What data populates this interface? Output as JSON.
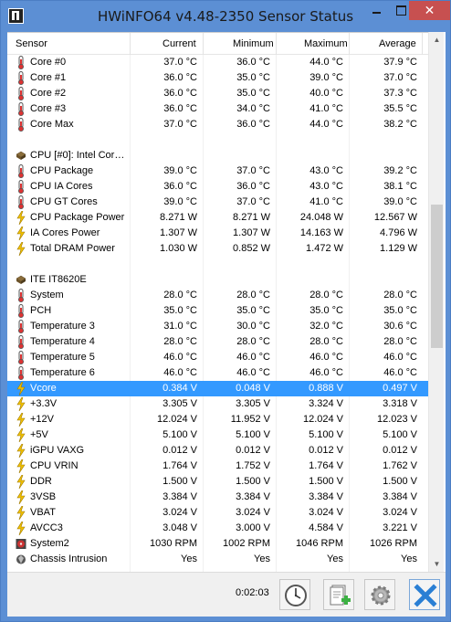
{
  "window": {
    "title": "HWiNFO64 v4.48-2350 Sensor Status",
    "close_label": "✕"
  },
  "columns": [
    "Sensor",
    "Current",
    "Minimum",
    "Maximum",
    "Average"
  ],
  "rows": [
    {
      "icon": "thermometer-icon",
      "label": "Core #0",
      "cur": "37.0 °C",
      "min": "36.0 °C",
      "max": "44.0 °C",
      "avg": "37.9 °C"
    },
    {
      "icon": "thermometer-icon",
      "label": "Core #1",
      "cur": "36.0 °C",
      "min": "35.0 °C",
      "max": "39.0 °C",
      "avg": "37.0 °C"
    },
    {
      "icon": "thermometer-icon",
      "label": "Core #2",
      "cur": "36.0 °C",
      "min": "35.0 °C",
      "max": "40.0 °C",
      "avg": "37.3 °C"
    },
    {
      "icon": "thermometer-icon",
      "label": "Core #3",
      "cur": "36.0 °C",
      "min": "34.0 °C",
      "max": "41.0 °C",
      "avg": "35.5 °C"
    },
    {
      "icon": "thermometer-icon",
      "label": "Core Max",
      "cur": "37.0 °C",
      "min": "36.0 °C",
      "max": "44.0 °C",
      "avg": "38.2 °C"
    },
    {
      "icon": "",
      "label": "",
      "cur": "",
      "min": "",
      "max": "",
      "avg": ""
    },
    {
      "icon": "chip-icon",
      "label": "CPU [#0]: Intel Cor…",
      "cur": "",
      "min": "",
      "max": "",
      "avg": "",
      "group": true
    },
    {
      "icon": "thermometer-icon",
      "label": "CPU Package",
      "cur": "39.0 °C",
      "min": "37.0 °C",
      "max": "43.0 °C",
      "avg": "39.2 °C"
    },
    {
      "icon": "thermometer-icon",
      "label": "CPU IA Cores",
      "cur": "36.0 °C",
      "min": "36.0 °C",
      "max": "43.0 °C",
      "avg": "38.1 °C"
    },
    {
      "icon": "thermometer-icon",
      "label": "CPU GT Cores",
      "cur": "39.0 °C",
      "min": "37.0 °C",
      "max": "41.0 °C",
      "avg": "39.0 °C"
    },
    {
      "icon": "lightning-icon",
      "label": "CPU Package Power",
      "cur": "8.271 W",
      "min": "8.271 W",
      "max": "24.048 W",
      "avg": "12.567 W"
    },
    {
      "icon": "lightning-icon",
      "label": "IA Cores Power",
      "cur": "1.307 W",
      "min": "1.307 W",
      "max": "14.163 W",
      "avg": "4.796 W"
    },
    {
      "icon": "lightning-icon",
      "label": "Total DRAM Power",
      "cur": "1.030 W",
      "min": "0.852 W",
      "max": "1.472 W",
      "avg": "1.129 W"
    },
    {
      "icon": "",
      "label": "",
      "cur": "",
      "min": "",
      "max": "",
      "avg": ""
    },
    {
      "icon": "chip-icon",
      "label": "ITE IT8620E",
      "cur": "",
      "min": "",
      "max": "",
      "avg": "",
      "group": true
    },
    {
      "icon": "thermometer-icon",
      "label": "System",
      "cur": "28.0 °C",
      "min": "28.0 °C",
      "max": "28.0 °C",
      "avg": "28.0 °C"
    },
    {
      "icon": "thermometer-icon",
      "label": "PCH",
      "cur": "35.0 °C",
      "min": "35.0 °C",
      "max": "35.0 °C",
      "avg": "35.0 °C"
    },
    {
      "icon": "thermometer-icon",
      "label": "Temperature 3",
      "cur": "31.0 °C",
      "min": "30.0 °C",
      "max": "32.0 °C",
      "avg": "30.6 °C"
    },
    {
      "icon": "thermometer-icon",
      "label": "Temperature 4",
      "cur": "28.0 °C",
      "min": "28.0 °C",
      "max": "28.0 °C",
      "avg": "28.0 °C"
    },
    {
      "icon": "thermometer-icon",
      "label": "Temperature 5",
      "cur": "46.0 °C",
      "min": "46.0 °C",
      "max": "46.0 °C",
      "avg": "46.0 °C"
    },
    {
      "icon": "thermometer-icon",
      "label": "Temperature 6",
      "cur": "46.0 °C",
      "min": "46.0 °C",
      "max": "46.0 °C",
      "avg": "46.0 °C"
    },
    {
      "icon": "lightning-icon",
      "label": "Vcore",
      "cur": "0.384 V",
      "min": "0.048 V",
      "max": "0.888 V",
      "avg": "0.497 V",
      "selected": true
    },
    {
      "icon": "lightning-icon",
      "label": "+3.3V",
      "cur": "3.305 V",
      "min": "3.305 V",
      "max": "3.324 V",
      "avg": "3.318 V"
    },
    {
      "icon": "lightning-icon",
      "label": "+12V",
      "cur": "12.024 V",
      "min": "11.952 V",
      "max": "12.024 V",
      "avg": "12.023 V"
    },
    {
      "icon": "lightning-icon",
      "label": "+5V",
      "cur": "5.100 V",
      "min": "5.100 V",
      "max": "5.100 V",
      "avg": "5.100 V"
    },
    {
      "icon": "lightning-icon",
      "label": "iGPU VAXG",
      "cur": "0.012 V",
      "min": "0.012 V",
      "max": "0.012 V",
      "avg": "0.012 V"
    },
    {
      "icon": "lightning-icon",
      "label": "CPU VRIN",
      "cur": "1.764 V",
      "min": "1.752 V",
      "max": "1.764 V",
      "avg": "1.762 V"
    },
    {
      "icon": "lightning-icon",
      "label": "DDR",
      "cur": "1.500 V",
      "min": "1.500 V",
      "max": "1.500 V",
      "avg": "1.500 V"
    },
    {
      "icon": "lightning-icon",
      "label": "3VSB",
      "cur": "3.384 V",
      "min": "3.384 V",
      "max": "3.384 V",
      "avg": "3.384 V"
    },
    {
      "icon": "lightning-icon",
      "label": "VBAT",
      "cur": "3.024 V",
      "min": "3.024 V",
      "max": "3.024 V",
      "avg": "3.024 V"
    },
    {
      "icon": "lightning-icon",
      "label": "AVCC3",
      "cur": "3.048 V",
      "min": "3.000 V",
      "max": "4.584 V",
      "avg": "3.221 V"
    },
    {
      "icon": "fan-icon",
      "label": "System2",
      "cur": "1030 RPM",
      "min": "1002 RPM",
      "max": "1046 RPM",
      "avg": "1026 RPM"
    },
    {
      "icon": "shield-icon",
      "label": "Chassis Intrusion",
      "cur": "Yes",
      "min": "Yes",
      "max": "Yes",
      "avg": "Yes"
    }
  ],
  "footer": {
    "elapsed": "0:02:03"
  },
  "colors": {
    "titlebar": "#5c8fd4",
    "selection": "#3399ff",
    "close": "#c75050"
  }
}
